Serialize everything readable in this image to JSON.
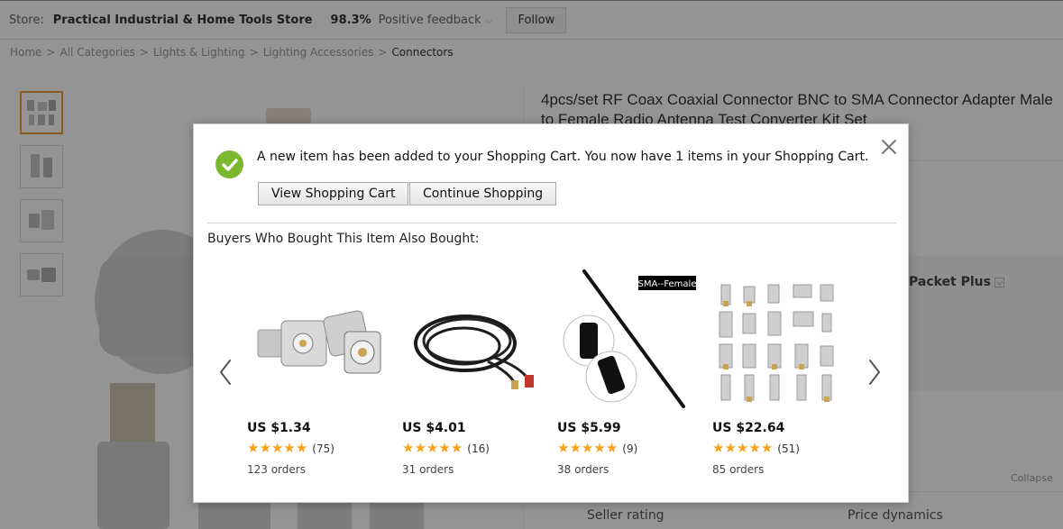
{
  "store": {
    "label": "Store:",
    "name": "Practical Industrial & Home Tools Store",
    "feedback_pct": "98.3%",
    "feedback_label": "Positive feedback",
    "follow_label": "Follow"
  },
  "breadcrumb": {
    "items": [
      "Home",
      "All Categories",
      "Lights & Lighting",
      "Lighting Accessories"
    ],
    "current": "Connectors",
    "separator": ">"
  },
  "product": {
    "title": "4pcs/set RF Coax Coaxial Connector BNC to SMA Connector Adapter Male to Female Radio Antenna Test Converter Kit Set",
    "shipping_option": "Packet Plus",
    "collapse_label": "Collapse",
    "seller_rating_label": "Seller rating",
    "price_dynamics_label": "Price dynamics"
  },
  "modal": {
    "message": "A new item has been added to your Shopping Cart. You now have 1 items in your Shopping Cart.",
    "view_cart_label": "View Shopping Cart",
    "continue_label": "Continue Shopping",
    "also_bought_label": "Buyers Who Bought This Item Also Bought:",
    "products": [
      {
        "price": "US $1.34",
        "rating": 5,
        "reviews": "(75)",
        "orders": "123 orders"
      },
      {
        "price": "US $4.01",
        "rating": 5,
        "reviews": "(16)",
        "orders": "31 orders"
      },
      {
        "price": "US $5.99",
        "rating": 5,
        "reviews": "(9)",
        "orders": "38 orders",
        "image_tag": "SMA--Female"
      },
      {
        "price": "US $22.64",
        "rating": 5,
        "reviews": "(51)",
        "orders": "85 orders"
      }
    ]
  },
  "colors": {
    "accent_orange": "#f7a21b",
    "check_green": "#7cb82f",
    "thumb_selected": "#f0a13a"
  },
  "icons": [
    "check-circle-icon",
    "close-icon",
    "chevron-left-icon",
    "chevron-right-icon",
    "star-icon",
    "chevron-down-icon"
  ]
}
